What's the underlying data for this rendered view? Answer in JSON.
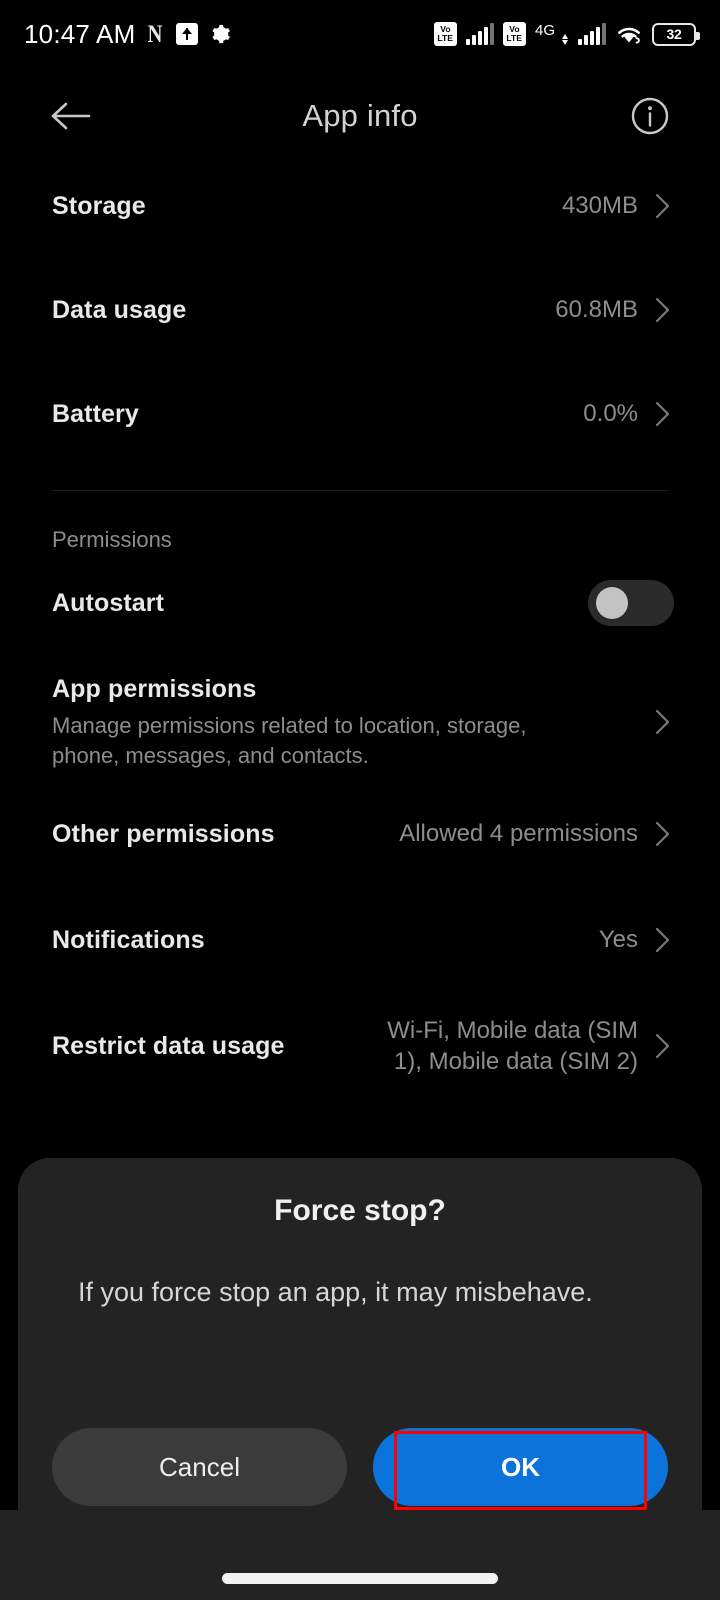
{
  "status_bar": {
    "time": "10:47 AM",
    "left_icons": [
      "netflix-n-icon",
      "upload-box-icon",
      "gear-icon"
    ],
    "netflix_glyph": "N",
    "sim1": {
      "volte_top": "Vo",
      "volte_bottom": "LTE",
      "signal_bars": 4
    },
    "sim2": {
      "volte_top": "Vo",
      "volte_bottom": "LTE",
      "network": "4G",
      "signal_bars": 4
    },
    "wifi": "wifi-icon",
    "battery": {
      "level": "32"
    }
  },
  "app_bar": {
    "back": "back-arrow-icon",
    "title": "App info",
    "info": "info-icon"
  },
  "list": {
    "rows": [
      {
        "title": "Storage",
        "value": "430MB",
        "chevron": true
      },
      {
        "title": "Data usage",
        "value": "60.8MB",
        "chevron": true
      },
      {
        "title": "Battery",
        "value": "0.0%",
        "chevron": true
      }
    ],
    "section_label": "Permissions",
    "autostart": {
      "title": "Autostart",
      "state": "off"
    },
    "app_permissions": {
      "title": "App permissions",
      "subtitle": "Manage permissions related to location, storage, phone, messages, and contacts."
    },
    "other_permissions": {
      "title": "Other permissions",
      "value": "Allowed 4 permissions"
    },
    "notifications": {
      "title": "Notifications",
      "value": "Yes"
    },
    "restrict_data": {
      "title": "Restrict data usage",
      "value": "Wi-Fi, Mobile data (SIM 1), Mobile data (SIM 2)"
    }
  },
  "dialog": {
    "title": "Force stop?",
    "message": "If you force stop an app, it may misbehave.",
    "cancel_label": "Cancel",
    "ok_label": "OK"
  },
  "colors": {
    "accent_blue": "#0b73d9",
    "highlight_red": "#ff0000",
    "dialog_bg": "#232323",
    "screen_bg": "#000000",
    "primary_text": "#e9e9e9",
    "secondary_text": "#8d8d8d"
  }
}
